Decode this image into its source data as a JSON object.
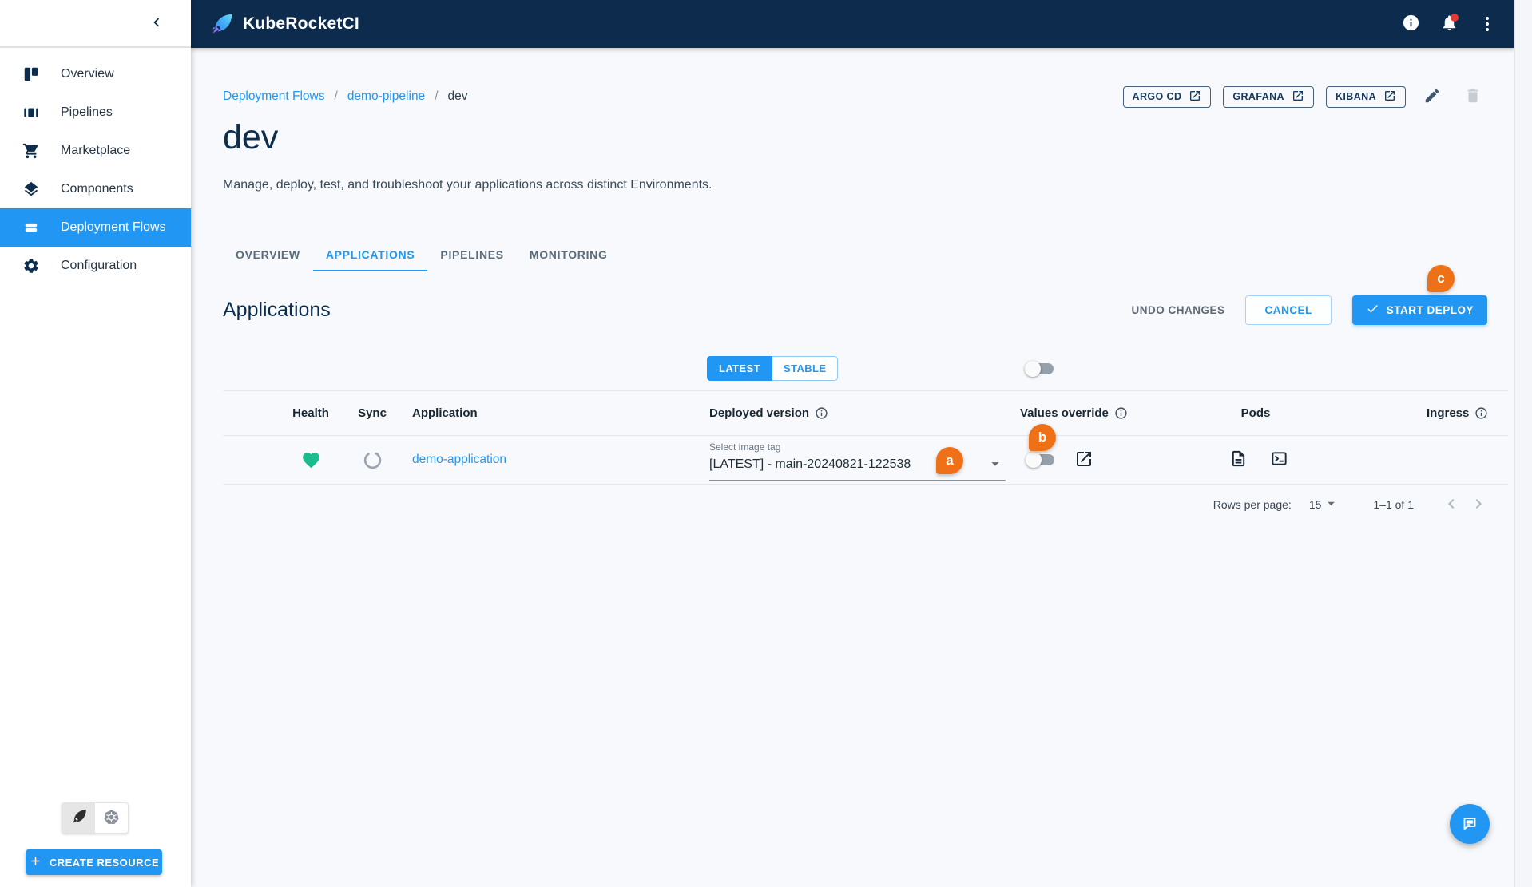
{
  "topbar": {
    "brand": "KubeRocketCI"
  },
  "sidebar": {
    "items": [
      {
        "label": "Overview",
        "icon": "overview-icon"
      },
      {
        "label": "Pipelines",
        "icon": "pipelines-icon"
      },
      {
        "label": "Marketplace",
        "icon": "marketplace-icon"
      },
      {
        "label": "Components",
        "icon": "components-icon"
      },
      {
        "label": "Deployment Flows",
        "icon": "deployment-flows-icon",
        "selected": true
      },
      {
        "label": "Configuration",
        "icon": "configuration-icon"
      }
    ],
    "create_button": "CREATE RESOURCE"
  },
  "breadcrumb": {
    "items": [
      "Deployment Flows",
      "demo-pipeline",
      "dev"
    ],
    "separator": "/"
  },
  "quick_links": [
    {
      "label": "ARGO CD"
    },
    {
      "label": "GRAFANA"
    },
    {
      "label": "KIBANA"
    }
  ],
  "page": {
    "title": "dev",
    "description": "Manage, deploy, test, and troubleshoot your applications across distinct Environments."
  },
  "tabs": [
    {
      "label": "OVERVIEW"
    },
    {
      "label": "APPLICATIONS",
      "active": true
    },
    {
      "label": "PIPELINES"
    },
    {
      "label": "MONITORING"
    }
  ],
  "applications_section": {
    "title": "Applications",
    "undo_button": "UNDO CHANGES",
    "cancel_button": "CANCEL",
    "deploy_button": "START DEPLOY"
  },
  "filter": {
    "latest": "LATEST",
    "stable": "STABLE",
    "selected": "LATEST",
    "master_override_switch": "off"
  },
  "table": {
    "headers": [
      "Health",
      "Sync",
      "Application",
      "Deployed version",
      "Values override",
      "Pods",
      "Ingress"
    ],
    "rows": [
      {
        "application": "demo-application",
        "health": "healthy",
        "sync": "unknown",
        "image_tag_label": "Select image tag",
        "image_tag_value": "[LATEST] - main-20240821-122538",
        "values_override_switch": "off"
      }
    ]
  },
  "pagination": {
    "rows_per_page_label": "Rows per page:",
    "rows_per_page_value": "15",
    "range_label": "1–1 of 1"
  },
  "annotations": {
    "a": "a",
    "b": "b",
    "c": "c"
  },
  "colors": {
    "accent": "#2196f3",
    "header_bg": "#0d2b4c",
    "annotation_orange": "#ef7117",
    "health_green": "#1abc8f",
    "content_bg": "#f7f9fc"
  }
}
